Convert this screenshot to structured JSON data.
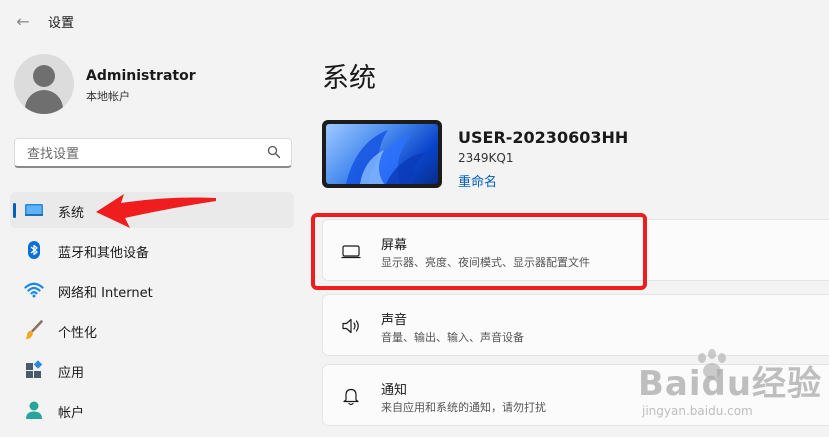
{
  "window": {
    "title": "设置"
  },
  "account": {
    "name": "Administrator",
    "type": "本地帐户"
  },
  "search": {
    "placeholder": "查找设置"
  },
  "nav": {
    "items": [
      {
        "label": "系统",
        "icon": "system-display-icon",
        "active": true
      },
      {
        "label": "蓝牙和其他设备",
        "icon": "bluetooth-icon"
      },
      {
        "label": "网络和 Internet",
        "icon": "wifi-icon"
      },
      {
        "label": "个性化",
        "icon": "brush-icon"
      },
      {
        "label": "应用",
        "icon": "apps-icon"
      },
      {
        "label": "帐户",
        "icon": "account-icon"
      }
    ]
  },
  "main": {
    "title": "系统",
    "device": {
      "name": "USER-20230603HH",
      "model": "2349KQ1",
      "rename": "重命名"
    },
    "cards": [
      {
        "title": "屏幕",
        "subtitle": "显示器、亮度、夜间模式、显示器配置文件",
        "icon": "monitor-icon"
      },
      {
        "title": "声音",
        "subtitle": "音量、输出、输入、声音设备",
        "icon": "speaker-icon"
      },
      {
        "title": "通知",
        "subtitle": "来自应用和系统的通知，请勿打扰",
        "icon": "bell-icon"
      }
    ]
  },
  "watermark": {
    "main": "Baidu经验",
    "sub": "jingyan.baidu.com"
  },
  "colors": {
    "accent": "#005fb8",
    "annotation": "#ef1d1d",
    "background": "#f3f3f3"
  }
}
